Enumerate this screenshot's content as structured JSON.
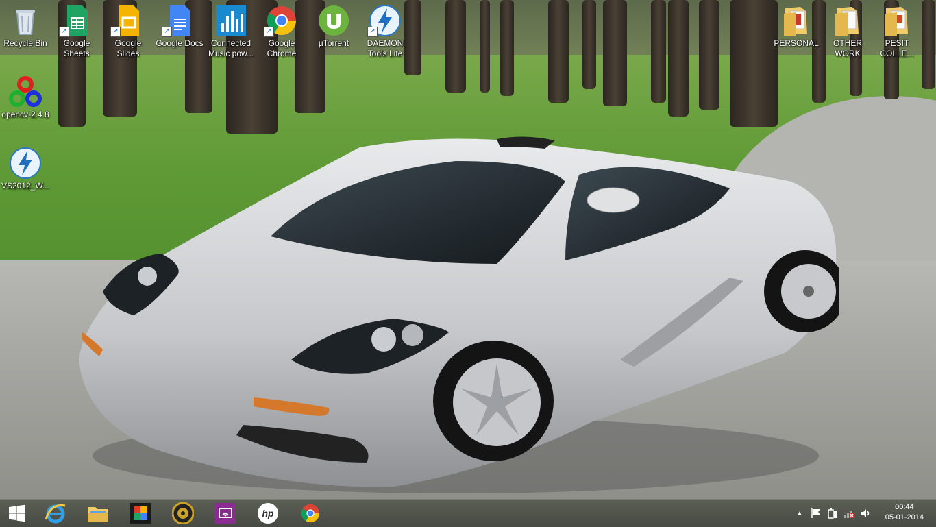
{
  "desktop": {
    "icons": [
      {
        "label": "Recycle Bin",
        "icon": "recycle-bin-icon"
      },
      {
        "label": "Google Sheets",
        "icon": "google-sheets-icon"
      },
      {
        "label": "Google Slides",
        "icon": "google-slides-icon"
      },
      {
        "label": "Google Docs",
        "icon": "google-docs-icon"
      },
      {
        "label": "Connected Music pow...",
        "icon": "connected-music-icon"
      },
      {
        "label": "Google Chrome",
        "icon": "chrome-icon"
      },
      {
        "label": "µTorrent",
        "icon": "utorrent-icon"
      },
      {
        "label": "DAEMON Tools Lite",
        "icon": "daemon-tools-icon"
      },
      {
        "label": "opencv-2.4.8",
        "icon": "opencv-icon"
      },
      {
        "label": "VS2012_W...",
        "icon": "vs2012-icon"
      },
      {
        "label": "PERSONAL",
        "icon": "folder-icon"
      },
      {
        "label": "OTHER WORK",
        "icon": "folder-icon"
      },
      {
        "label": "PESIT COLLE...",
        "icon": "folder-icon"
      }
    ]
  },
  "taskbar": {
    "items": [
      {
        "name": "start-button",
        "icon": "windows-logo-icon"
      },
      {
        "name": "internet-explorer",
        "icon": "internet-explorer-icon"
      },
      {
        "name": "file-explorer",
        "icon": "file-explorer-icon"
      },
      {
        "name": "photo-app",
        "icon": "photo-app-icon"
      },
      {
        "name": "media-player",
        "icon": "media-player-icon"
      },
      {
        "name": "wireless-display",
        "icon": "wireless-display-icon"
      },
      {
        "name": "hp-app",
        "icon": "hp-icon"
      },
      {
        "name": "google-chrome",
        "icon": "chrome-icon"
      }
    ],
    "clock": {
      "time": "00:44",
      "date": "05-01-2014"
    },
    "tray": [
      "show-hidden-icons-chevron",
      "action-center-flag-icon",
      "battery-icon",
      "network-disconnected-icon",
      "volume-icon"
    ]
  },
  "colors": {
    "taskbar": "#4c4f47",
    "accent_blue": "#1d75d8"
  }
}
